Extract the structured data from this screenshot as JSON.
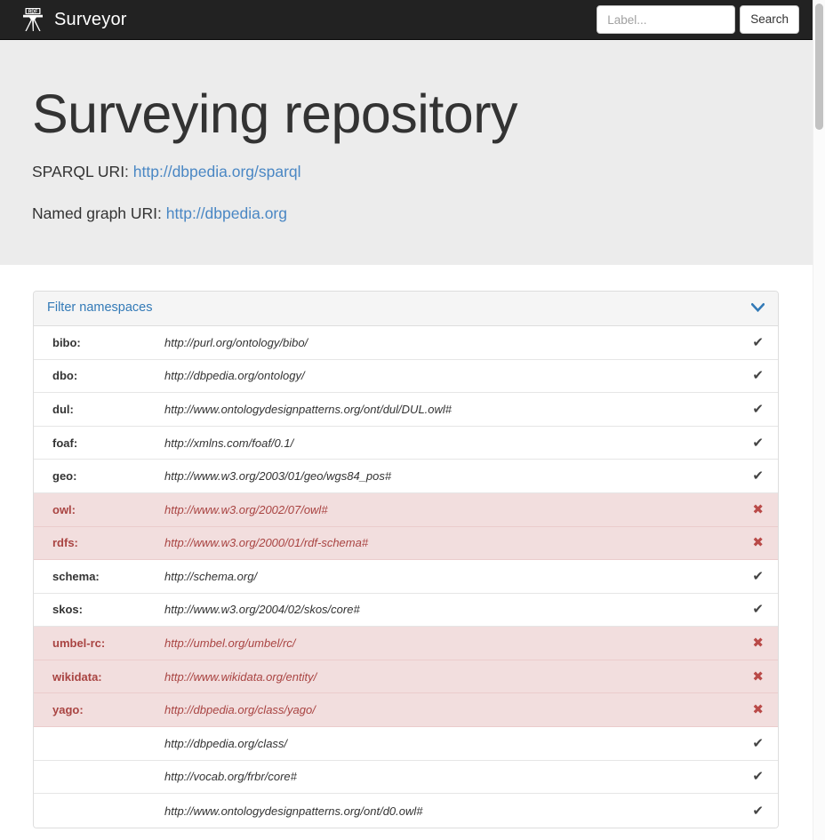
{
  "navbar": {
    "brand_label": "Surveyor",
    "brand_icon": "rdf-theodolite-icon",
    "logo_text": "RDF",
    "search": {
      "placeholder": "Label...",
      "value": "",
      "button_label": "Search"
    }
  },
  "hero": {
    "title": "Surveying repository",
    "sparql_label": "SPARQL URI:",
    "sparql_uri": "http://dbpedia.org/sparql",
    "graph_label": "Named graph URI:",
    "graph_uri": "http://dbpedia.org"
  },
  "panel": {
    "title": "Filter namespaces",
    "collapse_icon": "chevron-down-icon",
    "included_icon": "check-icon",
    "excluded_icon": "cross-icon",
    "included_glyph": "✔",
    "excluded_glyph": "✖",
    "namespaces": [
      {
        "prefix": "bibo:",
        "uri": "http://purl.org/ontology/bibo/",
        "state": "included"
      },
      {
        "prefix": "dbo:",
        "uri": "http://dbpedia.org/ontology/",
        "state": "included"
      },
      {
        "prefix": "dul:",
        "uri": "http://www.ontologydesignpatterns.org/ont/dul/DUL.owl#",
        "state": "included"
      },
      {
        "prefix": "foaf:",
        "uri": "http://xmlns.com/foaf/0.1/",
        "state": "included"
      },
      {
        "prefix": "geo:",
        "uri": "http://www.w3.org/2003/01/geo/wgs84_pos#",
        "state": "included"
      },
      {
        "prefix": "owl:",
        "uri": "http://www.w3.org/2002/07/owl#",
        "state": "excluded"
      },
      {
        "prefix": "rdfs:",
        "uri": "http://www.w3.org/2000/01/rdf-schema#",
        "state": "excluded"
      },
      {
        "prefix": "schema:",
        "uri": "http://schema.org/",
        "state": "included"
      },
      {
        "prefix": "skos:",
        "uri": "http://www.w3.org/2004/02/skos/core#",
        "state": "included"
      },
      {
        "prefix": "umbel-rc:",
        "uri": "http://umbel.org/umbel/rc/",
        "state": "excluded"
      },
      {
        "prefix": "wikidata:",
        "uri": "http://www.wikidata.org/entity/",
        "state": "excluded"
      },
      {
        "prefix": "yago:",
        "uri": "http://dbpedia.org/class/yago/",
        "state": "excluded"
      },
      {
        "prefix": "",
        "uri": "http://dbpedia.org/class/",
        "state": "included"
      },
      {
        "prefix": "",
        "uri": "http://vocab.org/frbr/core#",
        "state": "included"
      },
      {
        "prefix": "",
        "uri": "http://www.ontologydesignpatterns.org/ont/d0.owl#",
        "state": "included"
      }
    ]
  },
  "colors": {
    "navbar_bg": "#222222",
    "hero_bg": "#ececec",
    "link": "#4a87c4",
    "panel_title": "#337ab7",
    "excluded_bg": "#f2dede",
    "excluded_text": "#a94442",
    "check": "#444444",
    "cross": "#b94a48"
  }
}
